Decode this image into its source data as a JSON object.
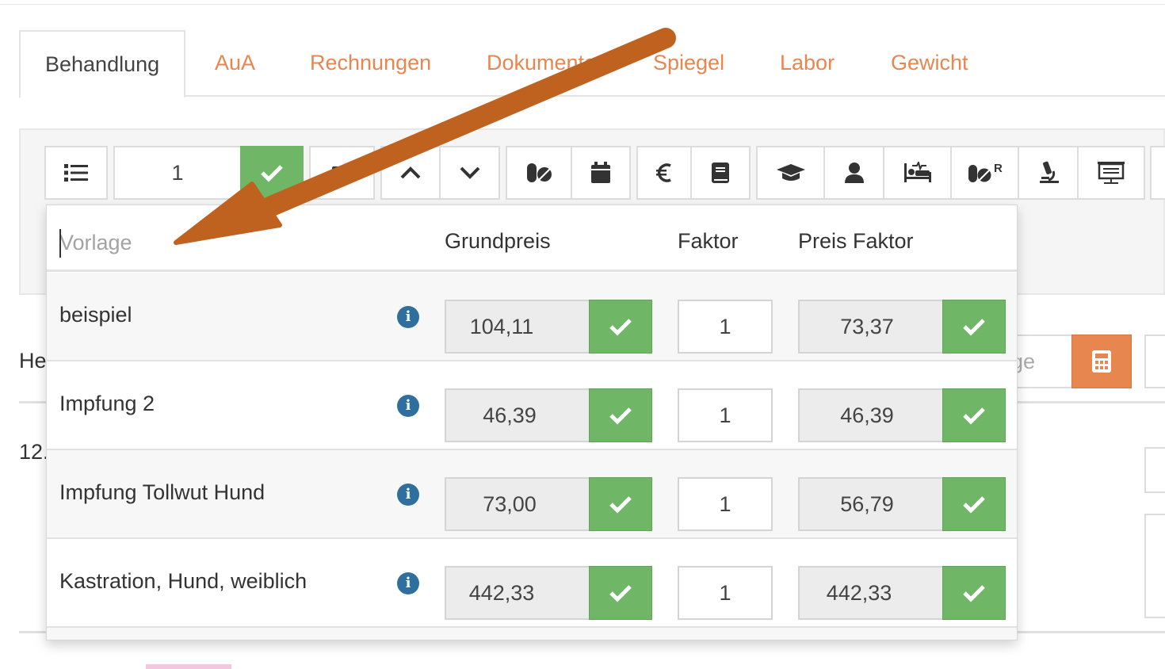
{
  "tabs": [
    {
      "label": "Behandlung",
      "active": true
    },
    {
      "label": "AuA"
    },
    {
      "label": "Rechnungen"
    },
    {
      "label": "Dokumente"
    },
    {
      "label": "Spiegel"
    },
    {
      "label": "Labor"
    },
    {
      "label": "Gewicht"
    }
  ],
  "toolbar": {
    "quantity": "1",
    "icons": [
      "list-icon",
      "check-icon",
      "chevron-up-icon",
      "chevron-down-icon",
      "pills-icon",
      "calendar-icon",
      "euro-icon",
      "book-icon",
      "graduation-cap-icon",
      "user-icon",
      "hospital-bed-icon",
      "pills-r-icon",
      "microscope-icon",
      "presentation-icon"
    ],
    "rx_superscript": "R"
  },
  "background": {
    "label_he": "He",
    "label_12": "12.",
    "input_fragment": "ge"
  },
  "dropdown": {
    "search_placeholder": "Vorlage",
    "columns": {
      "grundpreis": "Grundpreis",
      "faktor": "Faktor",
      "preis_faktor": "Preis Faktor"
    },
    "rows": [
      {
        "name": "beispiel",
        "grundpreis": "104,11",
        "faktor": "1",
        "preis_faktor": "73,37"
      },
      {
        "name": "Impfung 2",
        "grundpreis": "46,39",
        "faktor": "1",
        "preis_faktor": "46,39"
      },
      {
        "name": "Impfung Tollwut Hund",
        "grundpreis": "73,00",
        "faktor": "1",
        "preis_faktor": "56,79"
      },
      {
        "name": "Kastration, Hund, weiblich",
        "grundpreis": "442,33",
        "faktor": "1",
        "preis_faktor": "442,33"
      }
    ]
  },
  "colors": {
    "accent": "#e8864f",
    "success": "#6fb766",
    "info": "#2f6f9f",
    "arrow": "#c0621f"
  }
}
